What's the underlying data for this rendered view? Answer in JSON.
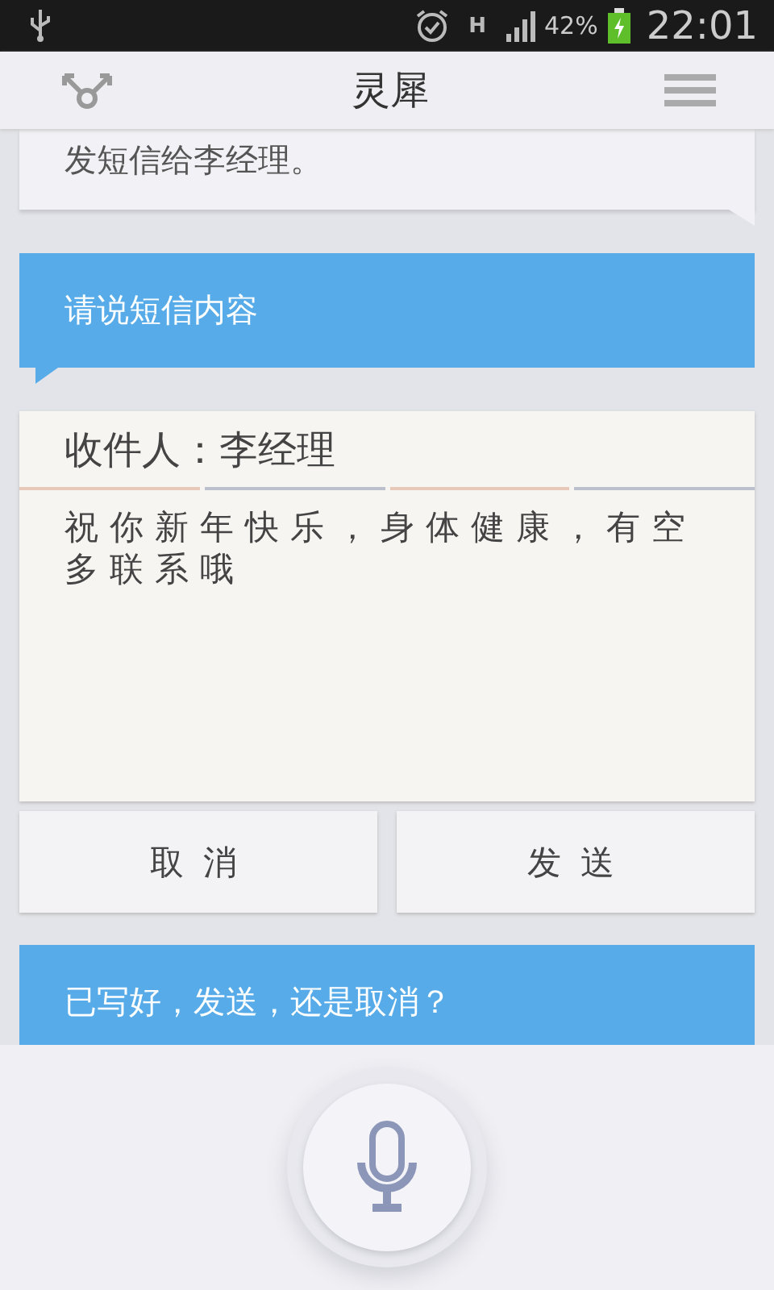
{
  "status_bar": {
    "network": "H",
    "battery": "42%",
    "time": "22:01"
  },
  "header": {
    "title": "灵犀"
  },
  "messages": [
    {
      "kind": "user",
      "text": "发短信给李经理。"
    },
    {
      "kind": "assistant",
      "text": "请说短信内容"
    },
    {
      "kind": "sms",
      "recipient": "收件人：李经理",
      "body": "祝你新年快乐，身体健康，有空多联系哦",
      "buttons": [
        "取消",
        "发送"
      ]
    },
    {
      "kind": "assistant",
      "text": "已写好，发送，还是取消？"
    }
  ]
}
